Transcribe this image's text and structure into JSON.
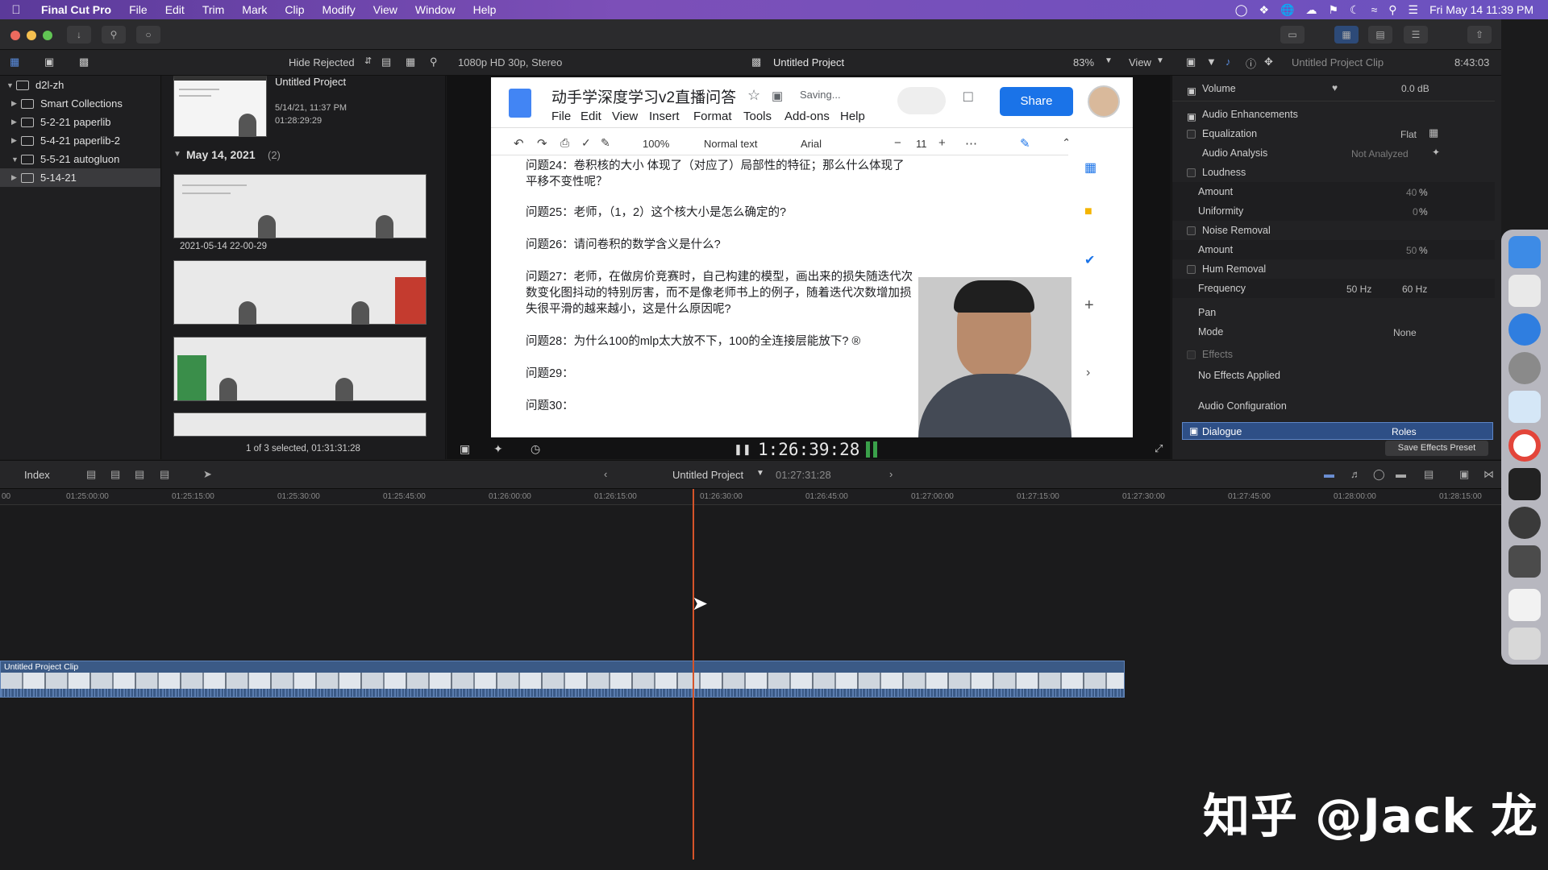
{
  "menubar": {
    "app": "Final Cut Pro",
    "items": [
      "File",
      "Edit",
      "Trim",
      "Mark",
      "Clip",
      "Modify",
      "View",
      "Window",
      "Help"
    ],
    "clock": "Fri May 14  11:39 PM"
  },
  "toolbar": {
    "hide_rejected": "Hide Rejected",
    "format": "1080p HD 30p, Stereo",
    "project_title": "Untitled Project",
    "zoom": "83%",
    "view": "View",
    "inspector_clip": "Untitled Project Clip",
    "duration": "8:43:03"
  },
  "libraries": {
    "root": "d2l-zh",
    "items": [
      "Smart Collections",
      "5-2-21 paperlib",
      "5-4-21 paperlib-2",
      "5-5-21 autogluon",
      "5-14-21"
    ]
  },
  "browser": {
    "project_name": "Untitled Project",
    "project_date": "5/14/21, 11:37 PM",
    "project_duration": "01:28:29:29",
    "group_label": "May 14, 2021",
    "group_count": "(2)",
    "clip_caption": "2021-05-14 22-00-29",
    "status": "1 of 3 selected, 01:31:31:28"
  },
  "doc": {
    "title": "动手学深度学习v2直播问答",
    "saving": "Saving...",
    "share": "Share",
    "menus": [
      "File",
      "Edit",
      "View",
      "Insert",
      "Format",
      "Tools",
      "Add-ons",
      "Help"
    ],
    "zoom": "100%",
    "style": "Normal text",
    "font": "Arial",
    "size": "11",
    "lines": [
      "问题24：卷积核的大小 体现了（对应了）局部性的特征；那么什么体现了",
      "平移不变性呢？",
      "问题25：老师，（1，2）这个核大小是怎么确定的?",
      "问题26：请问卷积的数学含义是什么?",
      "问题27：老师，在做房价竞赛时，自己构建的模型，画出来的损失随迭代次",
      "数变化图抖动的特别厉害，而不是像老师书上的例子，随着迭代次数增加损",
      "失很平滑的越来越小，这是什么原因呢?",
      "问题28：为什么100的mlp太大放不下，100的全连接层能放下? ®",
      "问题29：",
      "问题30："
    ]
  },
  "viewer": {
    "timecode": "1:26:39:28"
  },
  "inspector": {
    "volume_label": "Volume",
    "volume_value": "0.0 dB",
    "audio_enh": "Audio Enhancements",
    "equalization": "Equalization",
    "eq_value": "Flat",
    "audio_analysis": "Audio Analysis",
    "analysis_value": "Not Analyzed",
    "loudness": "Loudness",
    "amount": "Amount",
    "amount_value": "40",
    "uniformity": "Uniformity",
    "uniformity_value": "0",
    "noise_removal": "Noise Removal",
    "noise_amount": "50",
    "hum_removal": "Hum Removal",
    "frequency": "Frequency",
    "freq_50": "50 Hz",
    "freq_60": "60 Hz",
    "pan": "Pan",
    "mode": "Mode",
    "mode_value": "None",
    "effects": "Effects",
    "no_effects": "No Effects Applied",
    "audio_config": "Audio Configuration",
    "dialogue": "Dialogue",
    "roles": "Roles",
    "save_preset": "Save Effects Preset",
    "percent": "%"
  },
  "timeline": {
    "index": "Index",
    "project": "Untitled Project",
    "duration": "01:27:31:28",
    "ruler": [
      "00",
      "01:25:00:00",
      "01:25:15:00",
      "01:25:30:00",
      "01:25:45:00",
      "01:26:00:00",
      "01:26:15:00",
      "01:26:30:00",
      "01:26:45:00",
      "01:27:00:00",
      "01:27:15:00",
      "01:27:30:00",
      "01:27:45:00",
      "01:28:00:00",
      "01:28:15:00"
    ],
    "clip_label": "Untitled Project Clip"
  },
  "watermark": "知乎 @Jack 龙"
}
